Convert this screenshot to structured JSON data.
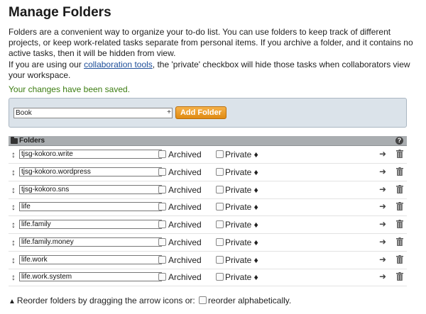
{
  "page": {
    "title": "Manage Folders",
    "intro": "Folders are a convenient way to organize your to-do list. You can use folders to keep track of different projects, or keep work-related tasks separate from personal items. If you archive a folder, and it contains no active tasks, then it will be hidden from view.",
    "collab_before": "If you are using our ",
    "collab_link": "collaboration tools",
    "collab_after": ", the 'private' checkbox will hide those tasks when collaborators view your workspace.",
    "saved_message": "Your changes have been saved."
  },
  "add_folder": {
    "input_value": "Book",
    "plus": "+",
    "button_label": "Add Folder"
  },
  "table": {
    "header_label": "Folders",
    "help_icon": "?",
    "archived_label": "Archived",
    "private_label": "Private ♦",
    "rows": [
      {
        "name": "tjsg-kokoro.write"
      },
      {
        "name": "tjsg-kokoro.wordpress"
      },
      {
        "name": "tjsg-kokoro.sns"
      },
      {
        "name": "life"
      },
      {
        "name": "life.family"
      },
      {
        "name": "life.family.money"
      },
      {
        "name": "life.work"
      },
      {
        "name": "life.work.system"
      }
    ]
  },
  "footer": {
    "text_before": "Reorder folders by dragging the arrow icons or:",
    "text_after": "reorder alphabetically."
  },
  "colors": {
    "saved_green": "#3d7d12",
    "add_button_orange": "#e08a12",
    "link_blue": "#1f4f9a",
    "header_gray": "#a9adb0"
  },
  "icons": {
    "drag": "drag-arrows-icon",
    "move": "arrow-right-icon",
    "delete": "trash-icon",
    "folder": "folder-icon",
    "help": "help-icon"
  }
}
